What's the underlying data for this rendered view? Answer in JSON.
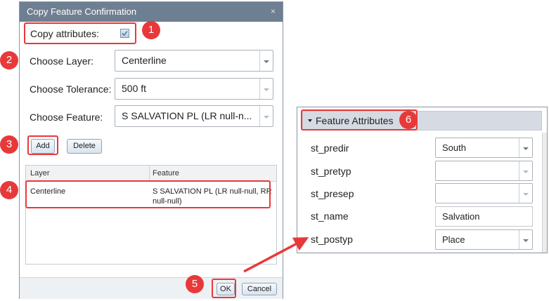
{
  "dialog": {
    "title": "Copy Feature Confirmation",
    "close_glyph": "×",
    "copy_attributes_label": "Copy attributes:",
    "copy_attributes_checked": true,
    "choose_layer_label": "Choose Layer:",
    "choose_layer_value": "Centerline",
    "choose_tolerance_label": "Choose Tolerance:",
    "choose_tolerance_value": "500 ft",
    "choose_feature_label": "Choose Feature:",
    "choose_feature_value": "S SALVATION PL (LR null-n...",
    "add_label": "Add",
    "delete_label": "Delete",
    "grid": {
      "columns": [
        "Layer",
        "Feature"
      ],
      "rows": [
        {
          "layer": "Centerline",
          "feature_line1": "S SALVATION PL (LR null-null, RR",
          "feature_line2": "null-null)"
        }
      ]
    },
    "ok_label": "OK",
    "cancel_label": "Cancel"
  },
  "panel": {
    "title": "Feature Attributes",
    "attributes": [
      {
        "name": "st_predir",
        "value": "South",
        "kind": "select"
      },
      {
        "name": "st_pretyp",
        "value": "",
        "kind": "select"
      },
      {
        "name": "st_presep",
        "value": "",
        "kind": "select"
      },
      {
        "name": "st_name",
        "value": "Salvation",
        "kind": "text"
      },
      {
        "name": "st_postyp",
        "value": "Place",
        "kind": "select"
      }
    ]
  },
  "callouts": [
    "1",
    "2",
    "3",
    "4",
    "5",
    "6"
  ],
  "colors": {
    "callout_red": "#e8393a",
    "title_bar": "#6f7f92",
    "panel_header": "#d6dbe3"
  },
  "icons": [
    "close-icon",
    "checkmark-icon",
    "chevron-down-icon",
    "collapse-triangle-icon",
    "arrow-connector-icon"
  ]
}
